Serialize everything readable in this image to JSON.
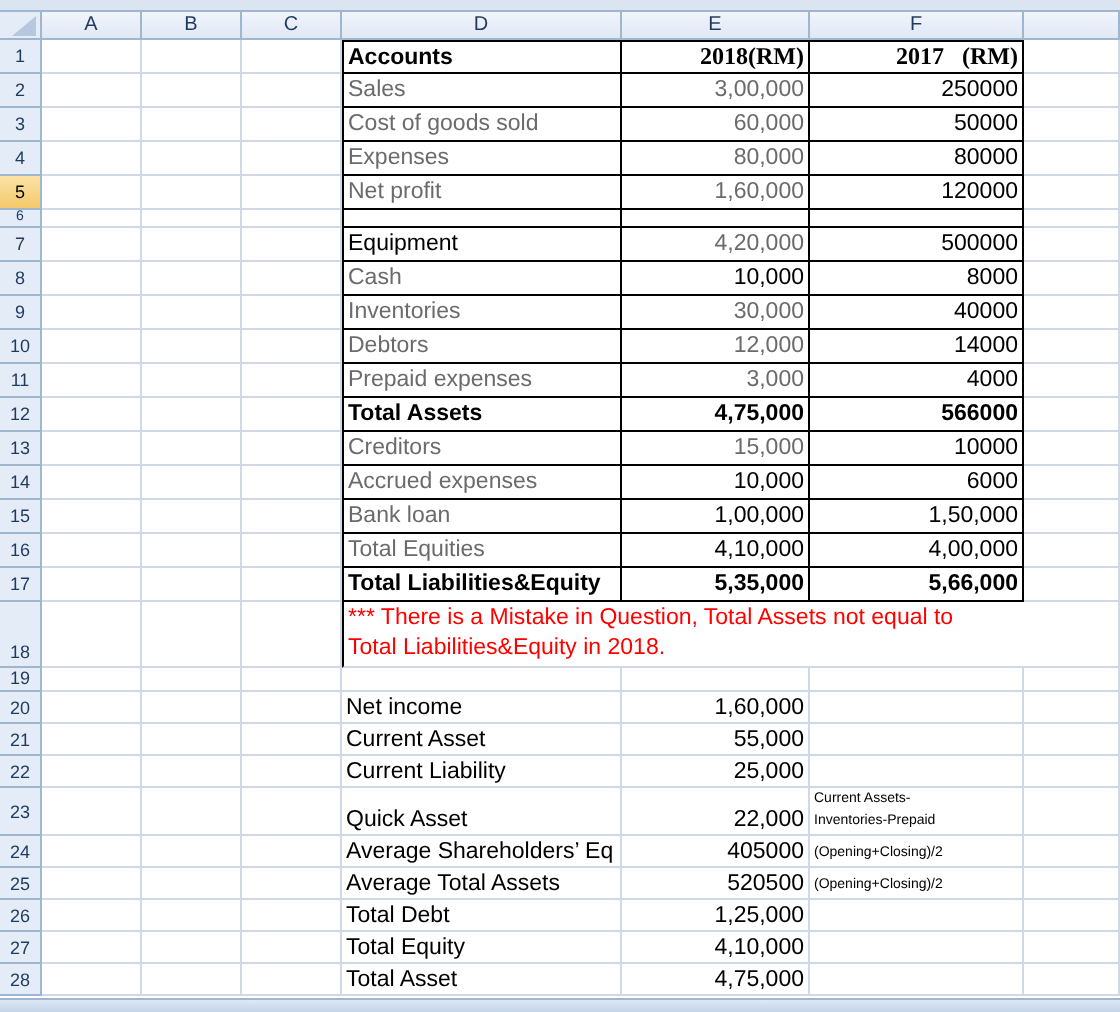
{
  "columns": [
    "A",
    "B",
    "C",
    "D",
    "E",
    "F"
  ],
  "rows": [
    {
      "number": "1",
      "selected": false,
      "kind": "heading",
      "cells": [
        {
          "text": "Accounts",
          "muted": false
        },
        {
          "text": "2018(RM)",
          "muted": false
        },
        {
          "text": "2017   (RM)",
          "muted": false
        }
      ]
    },
    {
      "number": "2",
      "selected": false,
      "kind": "table",
      "bold": false,
      "cells": [
        {
          "text": "Sales",
          "muted": true
        },
        {
          "text": "3,00,000",
          "muted": true
        },
        {
          "text": "250000",
          "muted": false
        }
      ]
    },
    {
      "number": "3",
      "selected": false,
      "kind": "table",
      "bold": false,
      "cells": [
        {
          "text": "Cost of goods sold",
          "muted": true
        },
        {
          "text": "60,000",
          "muted": true
        },
        {
          "text": "50000",
          "muted": false
        }
      ]
    },
    {
      "number": "4",
      "selected": false,
      "kind": "table",
      "bold": false,
      "cells": [
        {
          "text": "Expenses",
          "muted": true
        },
        {
          "text": "80,000",
          "muted": true
        },
        {
          "text": "80000",
          "muted": false
        }
      ]
    },
    {
      "number": "5",
      "selected": true,
      "kind": "table",
      "bold": false,
      "cells": [
        {
          "text": "Net profit",
          "muted": true
        },
        {
          "text": "1,60,000",
          "muted": true
        },
        {
          "text": "120000",
          "muted": false
        }
      ]
    },
    {
      "number": "6",
      "selected": false,
      "kind": "spacer"
    },
    {
      "number": "7",
      "selected": false,
      "kind": "table",
      "bold": false,
      "cells": [
        {
          "text": "Equipment",
          "muted": false
        },
        {
          "text": "4,20,000",
          "muted": true
        },
        {
          "text": "500000",
          "muted": false
        }
      ]
    },
    {
      "number": "8",
      "selected": false,
      "kind": "table",
      "bold": false,
      "cells": [
        {
          "text": "Cash",
          "muted": true
        },
        {
          "text": "10,000",
          "muted": false
        },
        {
          "text": "8000",
          "muted": false
        }
      ]
    },
    {
      "number": "9",
      "selected": false,
      "kind": "table",
      "bold": false,
      "cells": [
        {
          "text": "Inventories",
          "muted": true
        },
        {
          "text": "30,000",
          "muted": true
        },
        {
          "text": "40000",
          "muted": false
        }
      ]
    },
    {
      "number": "10",
      "selected": false,
      "kind": "table",
      "bold": false,
      "cells": [
        {
          "text": "Debtors",
          "muted": true
        },
        {
          "text": "12,000",
          "muted": true
        },
        {
          "text": "14000",
          "muted": false
        }
      ]
    },
    {
      "number": "11",
      "selected": false,
      "kind": "table",
      "bold": false,
      "cells": [
        {
          "text": "Prepaid expenses",
          "muted": true
        },
        {
          "text": "3,000",
          "muted": true
        },
        {
          "text": "4000",
          "muted": false
        }
      ]
    },
    {
      "number": "12",
      "selected": false,
      "kind": "table",
      "bold": true,
      "cells": [
        {
          "text": "Total Assets",
          "muted": false
        },
        {
          "text": "4,75,000",
          "muted": false
        },
        {
          "text": "566000",
          "muted": false
        }
      ]
    },
    {
      "number": "13",
      "selected": false,
      "kind": "table",
      "bold": false,
      "cells": [
        {
          "text": "Creditors",
          "muted": true
        },
        {
          "text": "15,000",
          "muted": true
        },
        {
          "text": "10000",
          "muted": false
        }
      ]
    },
    {
      "number": "14",
      "selected": false,
      "kind": "table",
      "bold": false,
      "cells": [
        {
          "text": "Accrued expenses",
          "muted": true
        },
        {
          "text": "10,000",
          "muted": false
        },
        {
          "text": "6000",
          "muted": false
        }
      ]
    },
    {
      "number": "15",
      "selected": false,
      "kind": "table",
      "bold": false,
      "cells": [
        {
          "text": "Bank loan",
          "muted": true
        },
        {
          "text": "1,00,000",
          "muted": false
        },
        {
          "text": "1,50,000",
          "muted": false
        }
      ]
    },
    {
      "number": "16",
      "selected": false,
      "kind": "table",
      "bold": false,
      "cells": [
        {
          "text": "Total Equities",
          "muted": true
        },
        {
          "text": "4,10,000",
          "muted": false
        },
        {
          "text": "4,00,000",
          "muted": false
        }
      ]
    },
    {
      "number": "17",
      "selected": false,
      "kind": "table",
      "bold": true,
      "cells": [
        {
          "text": "Total Liabilities&Equity",
          "muted": false
        },
        {
          "text": "5,35,000",
          "muted": false
        },
        {
          "text": "5,66,000",
          "muted": false
        }
      ]
    },
    {
      "number": "18",
      "selected": false,
      "kind": "note",
      "text": "*** There is a Mistake in Question, Total Assets not equal to Total Liabilities&Equity in 2018."
    },
    {
      "number": "19",
      "selected": false,
      "kind": "blank"
    },
    {
      "number": "20",
      "selected": false,
      "kind": "plain",
      "cells": [
        "Net income",
        "1,60,000"
      ]
    },
    {
      "number": "21",
      "selected": false,
      "kind": "plain",
      "cells": [
        "Current Asset",
        "55,000"
      ]
    },
    {
      "number": "22",
      "selected": false,
      "kind": "plain",
      "cells": [
        "Current Liability",
        "25,000"
      ]
    },
    {
      "number": "23",
      "selected": false,
      "kind": "plain",
      "cells": [
        "Quick Asset",
        "22,000",
        "Current Assets-\nInventories-Prepaid"
      ]
    },
    {
      "number": "24",
      "selected": false,
      "kind": "plain",
      "cells": [
        "Average Shareholders’ Eq",
        "405000",
        "(Opening+Closing)/2"
      ]
    },
    {
      "number": "25",
      "selected": false,
      "kind": "plain",
      "cells": [
        "Average Total Assets",
        "520500",
        "(Opening+Closing)/2"
      ]
    },
    {
      "number": "26",
      "selected": false,
      "kind": "plain",
      "cells": [
        "Total Debt",
        "1,25,000"
      ]
    },
    {
      "number": "27",
      "selected": false,
      "kind": "plain",
      "cells": [
        "Total Equity",
        "4,10,000"
      ]
    },
    {
      "number": "28",
      "selected": false,
      "kind": "plain",
      "cells": [
        "Total Asset",
        "4,75,000"
      ]
    }
  ]
}
